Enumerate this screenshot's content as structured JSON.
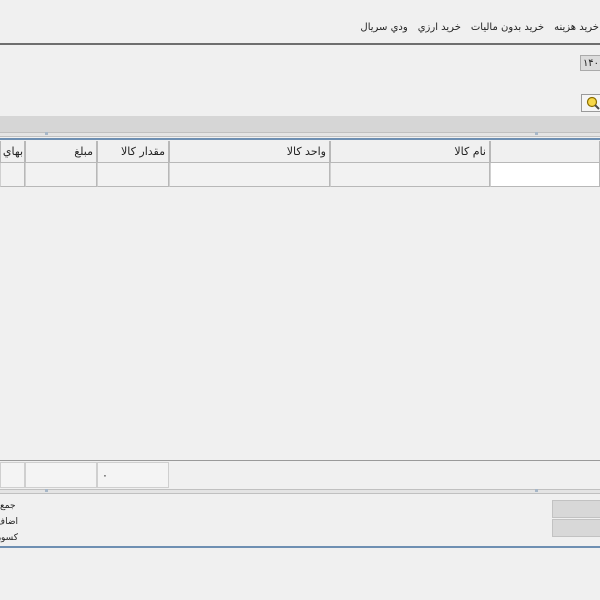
{
  "tabs": [
    "خريد هزينه",
    "خريد بدون ماليات",
    "خريد ارزي",
    "ودي سريال"
  ],
  "date_value": "۱۴۰",
  "table": {
    "columns": [
      "نام كالا",
      "واحد كالا",
      "مقدار كالا",
      "مبلغ",
      "بهاي"
    ]
  },
  "footer": {
    "amount_total": "۰"
  },
  "summary": {
    "labels": [
      "جمع",
      "اضاف",
      "كسور"
    ]
  },
  "icons": {
    "search": "search-icon"
  },
  "colors": {
    "accent_rule": "#6e8fb2",
    "search_icon": "#e6b800"
  }
}
